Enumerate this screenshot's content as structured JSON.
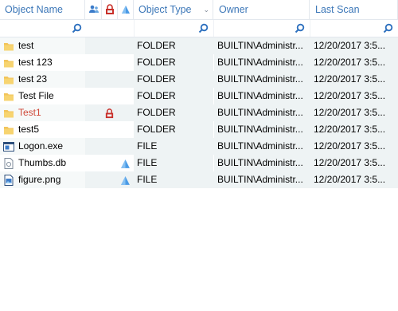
{
  "columns": {
    "name": "Object Name",
    "type": "Object Type",
    "owner": "Owner",
    "scan": "Last Scan",
    "icon1": "users-icon",
    "icon2": "lock-icon",
    "icon3": "warning-triangle-icon"
  },
  "rows": [
    {
      "name": "test",
      "icon": "folder-icon",
      "type": "FOLDER",
      "owner": "BUILTIN\\Administr...",
      "scan": "12/20/2017 3:5..."
    },
    {
      "name": "test 123",
      "icon": "folder-icon",
      "type": "FOLDER",
      "owner": "BUILTIN\\Administr...",
      "scan": "12/20/2017 3:5..."
    },
    {
      "name": "test 23",
      "icon": "folder-icon",
      "type": "FOLDER",
      "owner": "BUILTIN\\Administr...",
      "scan": "12/20/2017 3:5..."
    },
    {
      "name": "Test File",
      "icon": "folder-icon",
      "type": "FOLDER",
      "owner": "BUILTIN\\Administr...",
      "scan": "12/20/2017 3:5..."
    },
    {
      "name": "Test1",
      "icon": "folder-icon",
      "type": "FOLDER",
      "owner": "BUILTIN\\Administr...",
      "scan": "12/20/2017 3:5...",
      "flag": "lock-icon"
    },
    {
      "name": "test5",
      "icon": "folder-icon",
      "type": "FOLDER",
      "owner": "BUILTIN\\Administr...",
      "scan": "12/20/2017 3:5..."
    },
    {
      "name": "Logon.exe",
      "icon": "exe-file-icon",
      "type": "FILE",
      "owner": "BUILTIN\\Administr...",
      "scan": "12/20/2017 3:5..."
    },
    {
      "name": "Thumbs.db",
      "icon": "db-file-icon",
      "type": "FILE",
      "owner": "BUILTIN\\Administr...",
      "scan": "12/20/2017 3:5...",
      "flag": "warning-triangle-icon"
    },
    {
      "name": "figure.png",
      "icon": "image-file-icon",
      "type": "FILE",
      "owner": "BUILTIN\\Administr...",
      "scan": "12/20/2017 3:5...",
      "flag": "warning-triangle-icon"
    }
  ],
  "colors": {
    "header_text": "#3c77b8",
    "highlight_name": "#d04a3a",
    "folder": "#f2c45a",
    "row_alt": "#eef3f4"
  }
}
